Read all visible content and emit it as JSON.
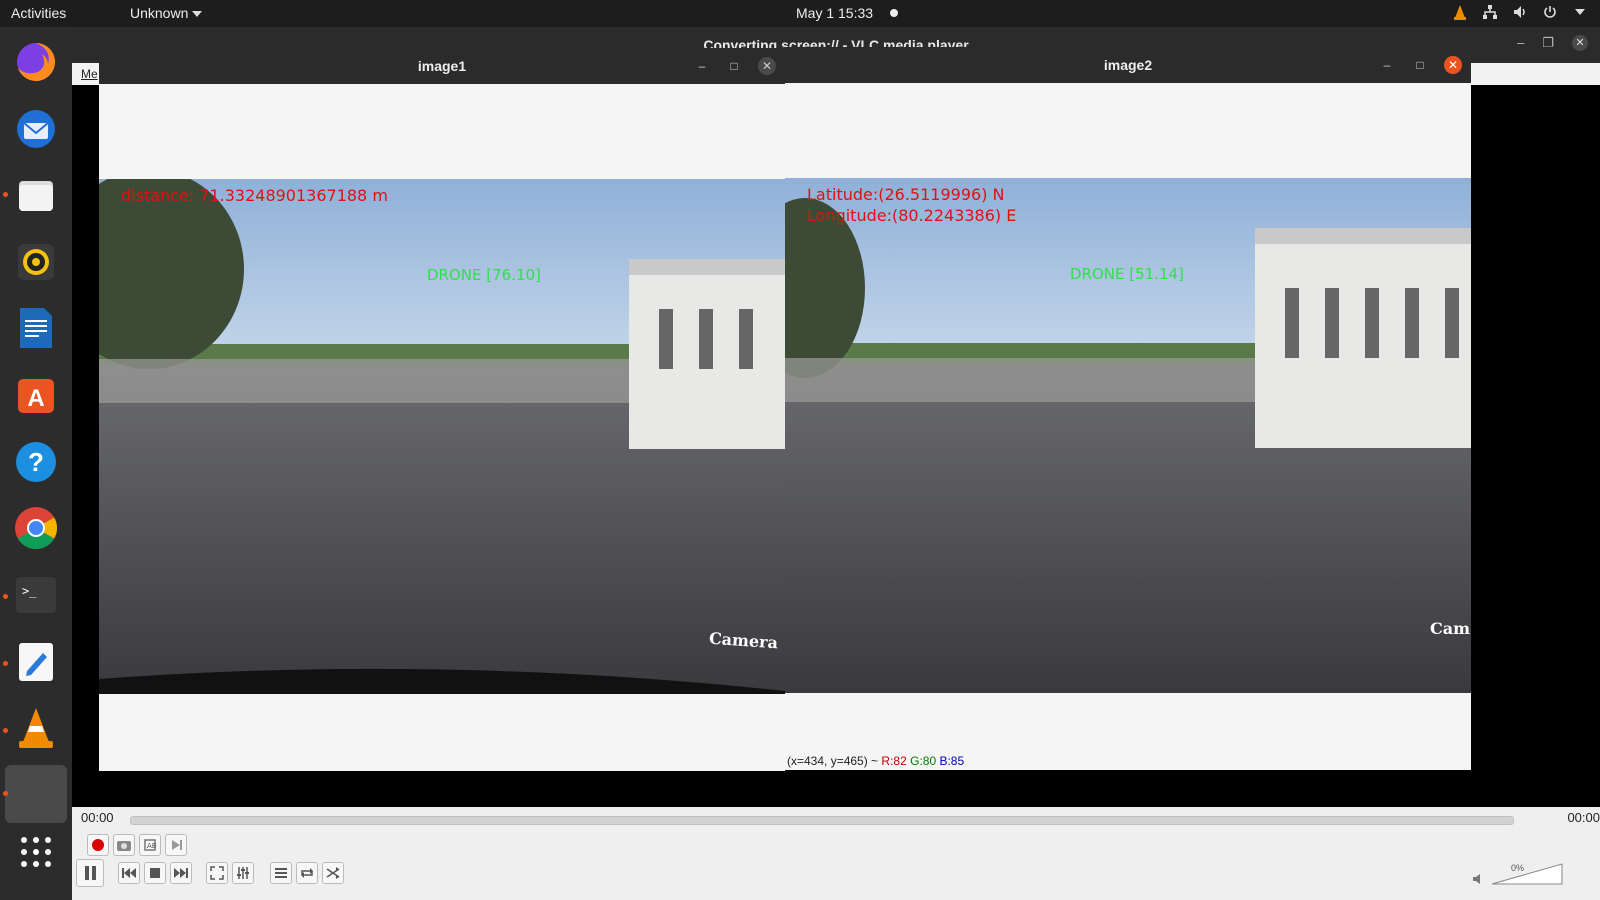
{
  "topbar": {
    "activities": "Activities",
    "app_menu": "Unknown",
    "clock": "May 1  15:33"
  },
  "dock": {
    "apps": [
      "firefox-icon",
      "thunderbird-icon",
      "files-icon",
      "rhythmbox-icon",
      "writer-icon",
      "software-icon",
      "help-icon",
      "chrome-icon",
      "terminal-icon",
      "text-editor-icon",
      "vlc-icon",
      "window-icon",
      "show-apps-icon"
    ]
  },
  "vlc": {
    "title": "Converting screen:// - VLC media player",
    "menu_fragment": "Me",
    "time_elapsed": "00:00",
    "time_total": "00:00",
    "volume": "0%"
  },
  "image1": {
    "title": "image1",
    "distance": "distance: 71.33248901367188 m",
    "drone": "DRONE [76.10]",
    "camera": "Camera"
  },
  "image2": {
    "title": "image2",
    "latitude": "Latitude:(26.5119996) N",
    "longitude": "Longitude:(80.2243386) E",
    "drone": "DRONE [51.14]",
    "camera": "Cam",
    "status_coords": "(x=434, y=465) ~",
    "status_r": "R:82",
    "status_g": "G:80",
    "status_b": "B:85"
  },
  "colors": {
    "accent": "#e95420",
    "overlay_red": "#e01111",
    "overlay_green": "#2fe04a"
  }
}
